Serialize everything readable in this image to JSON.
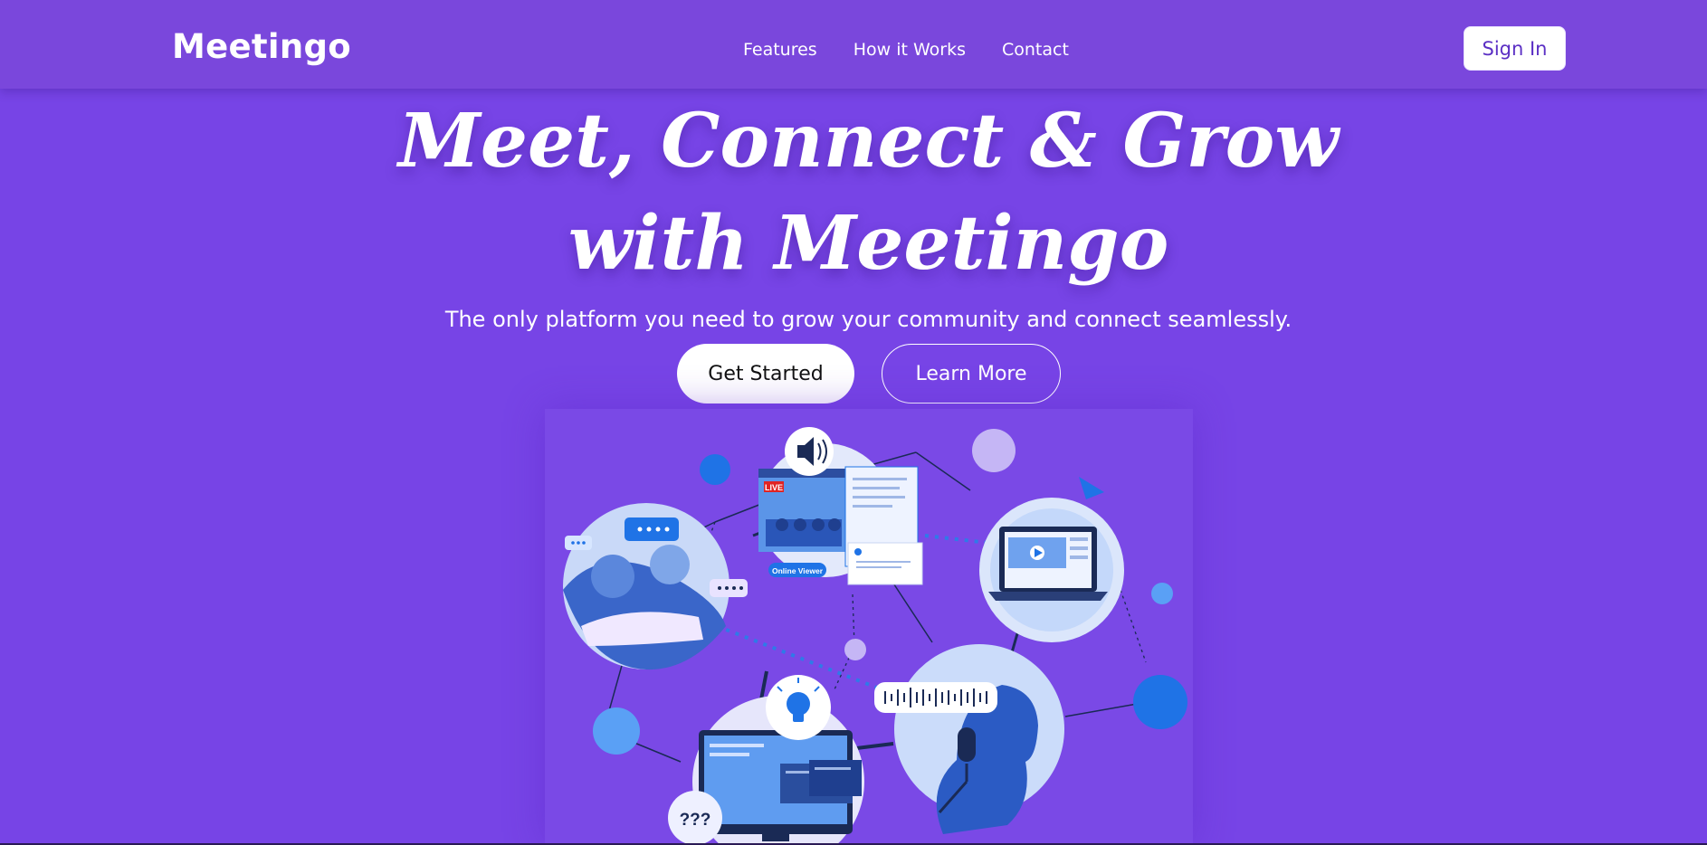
{
  "nav": {
    "logo": "Meetingo",
    "links": [
      "Features",
      "How it Works",
      "Contact"
    ],
    "signin_label": "Sign In"
  },
  "hero": {
    "title_line1": "Meet, Connect & Grow",
    "title_line2": "with Meetingo",
    "subtitle": "The only platform you need to grow your community and connect seamlessly.",
    "primary_cta": "Get Started",
    "secondary_cta": "Learn More"
  },
  "illustration": {
    "live_badge": "LIVE",
    "viewer_tag": "Online Viewer",
    "question_marks": "???",
    "icons": [
      "speaker-icon",
      "lightbulb-icon",
      "laptop-icon",
      "monitor-icon",
      "microphone-icon",
      "chat-bubble-icon"
    ]
  },
  "colors": {
    "background": "#7744e6",
    "navbar": "#7a47dc",
    "accent_blue": "#1f73e6",
    "light_blue": "#5aa0f5",
    "lavender": "#c5b6f5"
  }
}
